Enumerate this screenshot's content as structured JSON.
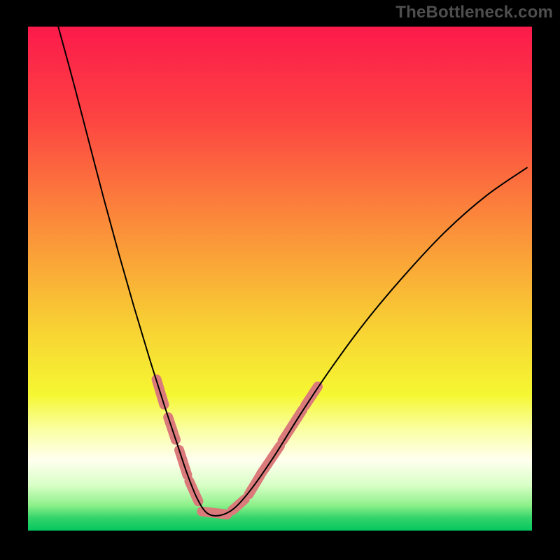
{
  "attribution": "TheBottleneck.com",
  "colors": {
    "frame": "#000000",
    "gradient_stops": [
      {
        "offset": 0.0,
        "color": "#fc1a4b"
      },
      {
        "offset": 0.18,
        "color": "#fd4342"
      },
      {
        "offset": 0.4,
        "color": "#fb8f3a"
      },
      {
        "offset": 0.6,
        "color": "#f8d233"
      },
      {
        "offset": 0.73,
        "color": "#f5f732"
      },
      {
        "offset": 0.8,
        "color": "#faffa3"
      },
      {
        "offset": 0.86,
        "color": "#ffffef"
      },
      {
        "offset": 0.91,
        "color": "#d8ffc6"
      },
      {
        "offset": 0.95,
        "color": "#8df08a"
      },
      {
        "offset": 0.975,
        "color": "#33d46a"
      },
      {
        "offset": 1.0,
        "color": "#05c65e"
      }
    ],
    "curve_stroke": "#000000",
    "highlight_stroke": "#db7a7a"
  },
  "chart_data": {
    "type": "line",
    "title": "",
    "xlabel": "",
    "ylabel": "",
    "xlim": [
      0,
      1
    ],
    "ylim": [
      0,
      1
    ],
    "notes": "Background is a vertical gradient from red (top, y≈1) through orange/yellow to green (bottom, y≈0). Curve is a V-shaped bottleneck curve with minimum near x≈0.35, y≈0.03. Pink highlight segments mark points along the lower portion of the curve.",
    "series": [
      {
        "name": "bottleneck-curve",
        "x": [
          0.06,
          0.09,
          0.12,
          0.15,
          0.18,
          0.21,
          0.24,
          0.27,
          0.295,
          0.315,
          0.335,
          0.355,
          0.38,
          0.41,
          0.445,
          0.49,
          0.54,
          0.6,
          0.67,
          0.75,
          0.83,
          0.91,
          0.99
        ],
        "y": [
          1.0,
          0.89,
          0.775,
          0.66,
          0.55,
          0.445,
          0.345,
          0.25,
          0.175,
          0.115,
          0.065,
          0.035,
          0.03,
          0.045,
          0.085,
          0.15,
          0.23,
          0.32,
          0.415,
          0.51,
          0.595,
          0.665,
          0.72
        ]
      }
    ],
    "highlight_segments": [
      {
        "x": [
          0.255,
          0.27
        ],
        "y": [
          0.3,
          0.25
        ]
      },
      {
        "x": [
          0.278,
          0.293
        ],
        "y": [
          0.225,
          0.18
        ]
      },
      {
        "x": [
          0.3,
          0.316
        ],
        "y": [
          0.16,
          0.11
        ]
      },
      {
        "x": [
          0.32,
          0.338
        ],
        "y": [
          0.098,
          0.058
        ]
      },
      {
        "x": [
          0.345,
          0.395
        ],
        "y": [
          0.038,
          0.032
        ]
      },
      {
        "x": [
          0.405,
          0.43
        ],
        "y": [
          0.04,
          0.062
        ]
      },
      {
        "x": [
          0.438,
          0.46
        ],
        "y": [
          0.072,
          0.108
        ]
      },
      {
        "x": [
          0.462,
          0.5
        ],
        "y": [
          0.112,
          0.168
        ]
      },
      {
        "x": [
          0.505,
          0.545
        ],
        "y": [
          0.178,
          0.24
        ]
      },
      {
        "x": [
          0.55,
          0.575
        ],
        "y": [
          0.248,
          0.286
        ]
      }
    ]
  }
}
